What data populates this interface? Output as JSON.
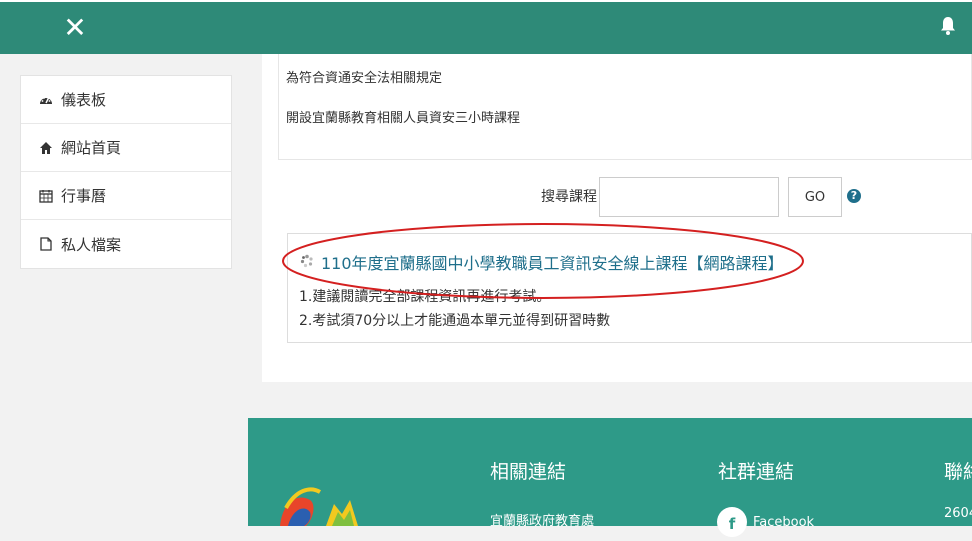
{
  "topbar": {
    "close_icon": "close-icon",
    "bell_icon": "bell-icon",
    "color": "#2e8a78"
  },
  "sidebar": {
    "items": [
      {
        "label": "儀表板",
        "icon": "dashboard-icon"
      },
      {
        "label": "網站首頁",
        "icon": "home-icon"
      },
      {
        "label": "行事曆",
        "icon": "calendar-icon"
      },
      {
        "label": "私人檔案",
        "icon": "file-icon"
      }
    ]
  },
  "intro": {
    "line1": "為符合資通安全法相關規定",
    "line2": "開設宜蘭縣教育相關人員資安三小時課程"
  },
  "search": {
    "label": "搜尋課程",
    "input_value": "",
    "go_label": "GO",
    "help": "?"
  },
  "course": {
    "title": "110年度宜蘭縣國中小學教職員工資訊安全線上課程【網路課程】",
    "line1": "1.建議閱讀完全部課程資訊再進行考試。",
    "line2": "2.考試須70分以上才能通過本單元並得到研習時數",
    "highlight_color": "#d42020"
  },
  "footer": {
    "related_heading": "相關連結",
    "related_link1": "宜蘭縣政府教育處",
    "social_heading": "社群連結",
    "facebook": "Facebook",
    "contact_heading": "聯絡",
    "contact_line": "2604",
    "color": "#2e9a88"
  }
}
